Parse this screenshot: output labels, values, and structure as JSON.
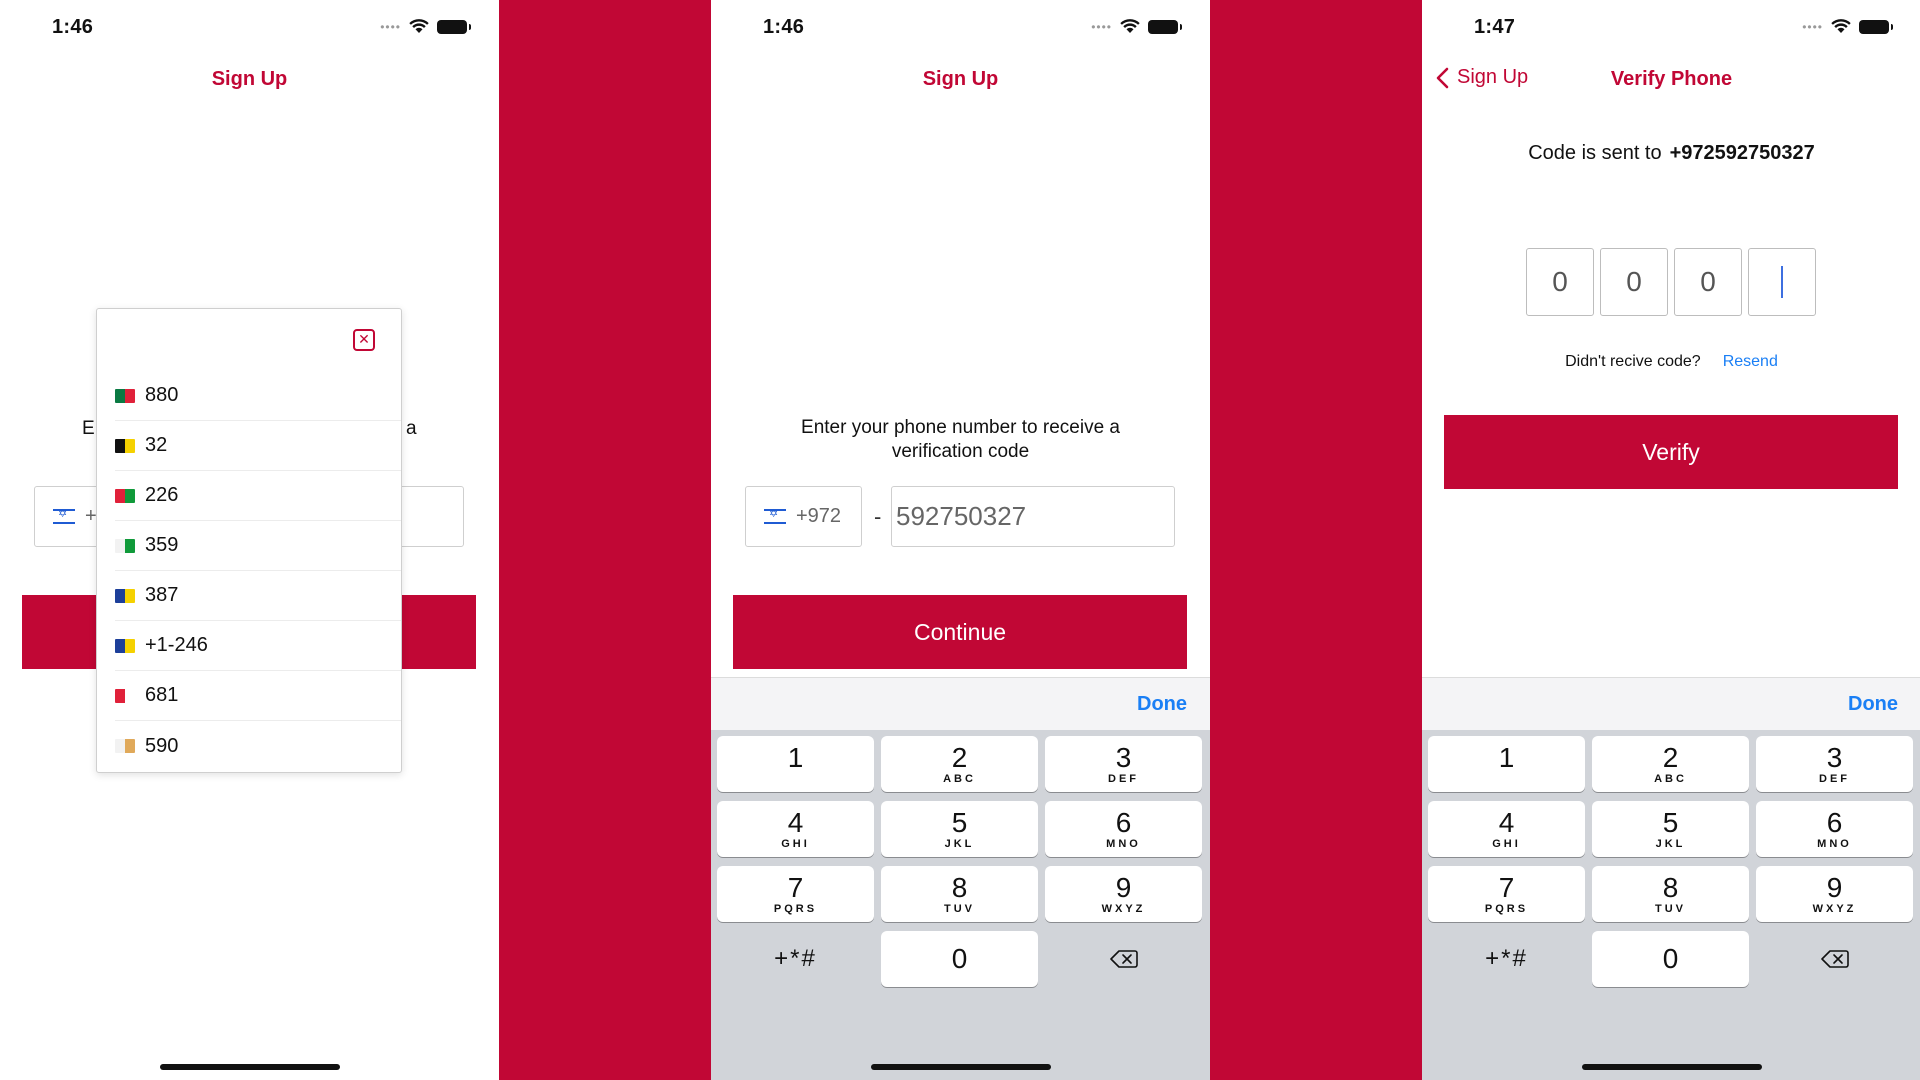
{
  "colors": {
    "brand": "#c10735",
    "link": "#1a7ff5",
    "keyboard_bg": "#d1d4d9"
  },
  "screen1": {
    "time": "1:46",
    "title": "Sign Up",
    "prompt_left": "E",
    "prompt_right": "a",
    "country_code_partial": "+",
    "countries": [
      {
        "code": "880",
        "flag": "bangladesh-flag-icon",
        "c1": "#0a7a43",
        "c2": "#e0213a"
      },
      {
        "code": "32",
        "flag": "belgium-flag-icon",
        "c1": "#111111",
        "c2": "#f5d100"
      },
      {
        "code": "226",
        "flag": "burkina-faso-flag-icon",
        "c1": "#e0213a",
        "c2": "#109a3a"
      },
      {
        "code": "359",
        "flag": "bulgaria-flag-icon",
        "c1": "#f2f2f2",
        "c2": "#109a3a"
      },
      {
        "code": "387",
        "flag": "bosnia-flag-icon",
        "c1": "#1d3f9a",
        "c2": "#f5d100"
      },
      {
        "code": "+1-246",
        "flag": "barbados-flag-icon",
        "c1": "#1d3f9a",
        "c2": "#f5d100"
      },
      {
        "code": "681",
        "flag": "wallis-futuna-flag-icon",
        "c1": "#e0213a",
        "c2": "#ffffff"
      },
      {
        "code": "590",
        "flag": "saint-barthelemy-flag-icon",
        "c1": "#f2f2f2",
        "c2": "#e0a95a"
      }
    ]
  },
  "screen2": {
    "time": "1:46",
    "title": "Sign Up",
    "prompt": "Enter your phone number to receive a verification code",
    "country_code": "+972",
    "dash": "-",
    "phone_number": "592750327",
    "continue_label": "Continue",
    "done_label": "Done"
  },
  "screen3": {
    "time": "1:47",
    "back_label": "Sign Up",
    "title": "Verify Phone",
    "sent_text": "Code is sent to",
    "sent_number": "+972592750327",
    "code_digits": [
      "0",
      "0",
      "0"
    ],
    "didnt_receive": "Didn't recive code?",
    "resend_label": "Resend",
    "verify_label": "Verify",
    "done_label": "Done"
  },
  "keyboard": {
    "keys": [
      {
        "digit": "1",
        "letters": ""
      },
      {
        "digit": "2",
        "letters": "ABC"
      },
      {
        "digit": "3",
        "letters": "DEF"
      },
      {
        "digit": "4",
        "letters": "GHI"
      },
      {
        "digit": "5",
        "letters": "JKL"
      },
      {
        "digit": "6",
        "letters": "MNO"
      },
      {
        "digit": "7",
        "letters": "PQRS"
      },
      {
        "digit": "8",
        "letters": "TUV"
      },
      {
        "digit": "9",
        "letters": "WXYZ"
      }
    ],
    "symbols": "+*#",
    "zero": "0"
  }
}
